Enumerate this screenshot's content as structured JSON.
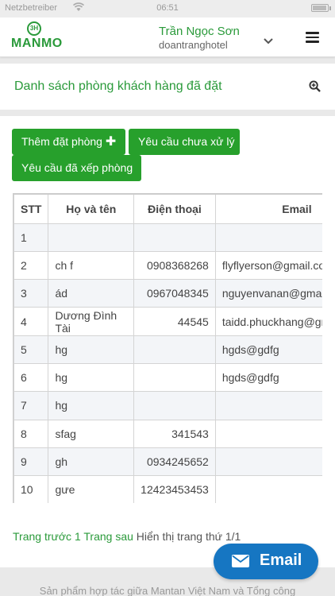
{
  "status_bar": {
    "carrier": "Netzbetreiber",
    "time": "06:51"
  },
  "header": {
    "logo_text": "MANMO",
    "logo_badge": "3H",
    "user_name": "Trần Ngọc Sơn",
    "hotel": "doantranghotel",
    "chevron_icon": "chevron-down-icon",
    "menu_icon": "hamburger-menu-icon"
  },
  "page": {
    "title": "Danh sách phòng khách hàng đã đặt",
    "search_icon": "zoom-in-icon"
  },
  "buttons": {
    "add_booking": "Thêm đặt phòng",
    "pending": "Yêu cầu chưa xử lý",
    "arranged": "Yêu cầu đã xếp phòng"
  },
  "table": {
    "headers": [
      "STT",
      "Họ và tên",
      "Điện thoại",
      "Email"
    ],
    "rows": [
      [
        "1",
        "",
        "",
        ""
      ],
      [
        "2",
        "ch f",
        "0908368268",
        "flyflyerson@gmail.com"
      ],
      [
        "3",
        "ád",
        "0967048345",
        "nguyenvanan@gmail.com"
      ],
      [
        "4",
        "Dương Đình Tài",
        "44545",
        "taidd.phuckhang@gmail.com"
      ],
      [
        "5",
        "hg",
        "",
        "hgds@gdfg"
      ],
      [
        "6",
        "hg",
        "",
        "hgds@gdfg"
      ],
      [
        "7",
        "hg",
        "",
        ""
      ],
      [
        "8",
        "sfag",
        "341543",
        ""
      ],
      [
        "9",
        "gh",
        "0934245652",
        ""
      ],
      [
        "10",
        "gưe",
        "12423453453",
        ""
      ]
    ]
  },
  "pager": {
    "prev": "Trang trước",
    "current": "1",
    "next": "Trang sau",
    "info": "Hiển thị trang thứ 1/1"
  },
  "fab": {
    "label": "Email",
    "icon": "envelope-icon"
  },
  "footer": {
    "text": "Sản phẩm hợp tác giữa Mantan Việt Nam và Tổng công"
  },
  "colors": {
    "brand_green": "#27a02c",
    "fab_blue": "#1676c2"
  }
}
